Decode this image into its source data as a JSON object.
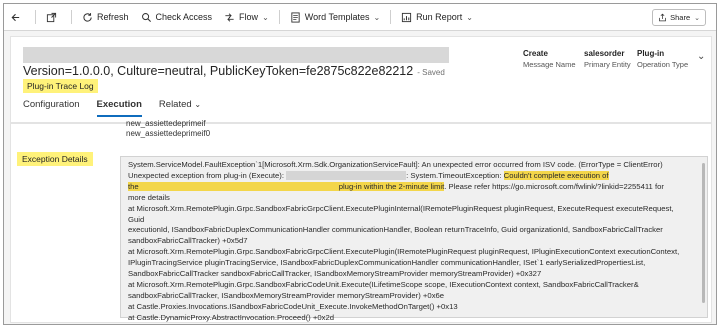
{
  "toolbar": {
    "refresh": "Refresh",
    "check_access": "Check Access",
    "flow": "Flow",
    "word_templates": "Word Templates",
    "run_report": "Run Report",
    "share": "Share"
  },
  "header": {
    "title": "Version=1.0.0.0, Culture=neutral, PublicKeyToken=fe2875c822e82212",
    "saved": "- Saved",
    "entity_type": "Plug-in Trace Log",
    "fields": [
      {
        "value": "Create",
        "label": "Message Name"
      },
      {
        "value": "salesorder",
        "label": "Primary Entity"
      },
      {
        "value": "Plug-in",
        "label": "Operation Type"
      }
    ],
    "tabs": [
      "Configuration",
      "Execution",
      "Related"
    ]
  },
  "body": {
    "prev_line_1": "new_assiettedeprimeif",
    "prev_line_2": "new_assiettedeprimeif0",
    "exception_label": "Exception Details",
    "exception": {
      "line1": "System.ServiceModel.FaultException`1[Microsoft.Xrm.Sdk.OrganizationServiceFault]: An unexpected error occurred from ISV code. (ErrorType = ClientError)",
      "line2a": "Unexpected exception from plug-in (Execute):",
      "line2b": ": System.TimeoutException:",
      "line2c": "Couldn't complete execution of",
      "line3a": "the",
      "line3b": "plug-in within the 2-minute limit",
      "line3c": ". Please refer https://go.microsoft.com/fwlink/?linkid=2255411 for",
      "line4": "more details",
      "line5": "at Microsoft.Xrm.RemotePlugin.Grpc.SandboxFabricGrpcClient.ExecutePluginInternal(IRemotePluginRequest pluginRequest, ExecuteRequest executeRequest, Guid",
      "line6": "executionId, ISandboxFabricDuplexCommunicationHandler communicationHandler, Boolean returnTraceInfo, Guid organizationId, SandboxFabricCallTracker",
      "line7": "sandboxFabricCallTracker) +0x5d7",
      "line8": "at Microsoft.Xrm.RemotePlugin.Grpc.SandboxFabricGrpcClient.ExecutePlugin(IRemotePluginRequest pluginRequest, IPluginExecutionContext executionContext,",
      "line9": "IPluginTracingService pluginTracingService, ISandboxFabricDuplexCommunicationHandler communicationHandler, ISet`1 earlySerializedPropertiesList,",
      "line10": "SandboxFabricCallTracker sandboxFabricCallTracker, ISandboxMemoryStreamProvider memoryStreamProvider) +0x327",
      "line11": "at Microsoft.Xrm.RemotePlugin.Grpc.SandboxFabricCodeUnit.Execute(ILifetimeScope scope, IExecutionContext context, SandboxFabricCallTracker&",
      "line12": "sandboxFabricCallTracker, ISandboxMemoryStreamProvider memoryStreamProvider) +0x6e",
      "line13": "at Castle.Proxies.Invocations.ISandboxFabricCodeUnit_Execute.InvokeMethodOnTarget() +0x13",
      "line14": "at Castle.DynamicProxy.AbstractInvocation.Proceed() +0x2d"
    }
  },
  "colors": {
    "highlight": "#fff27a",
    "highlight_text": "#f3d64a",
    "accent": "#0f6cbd"
  }
}
